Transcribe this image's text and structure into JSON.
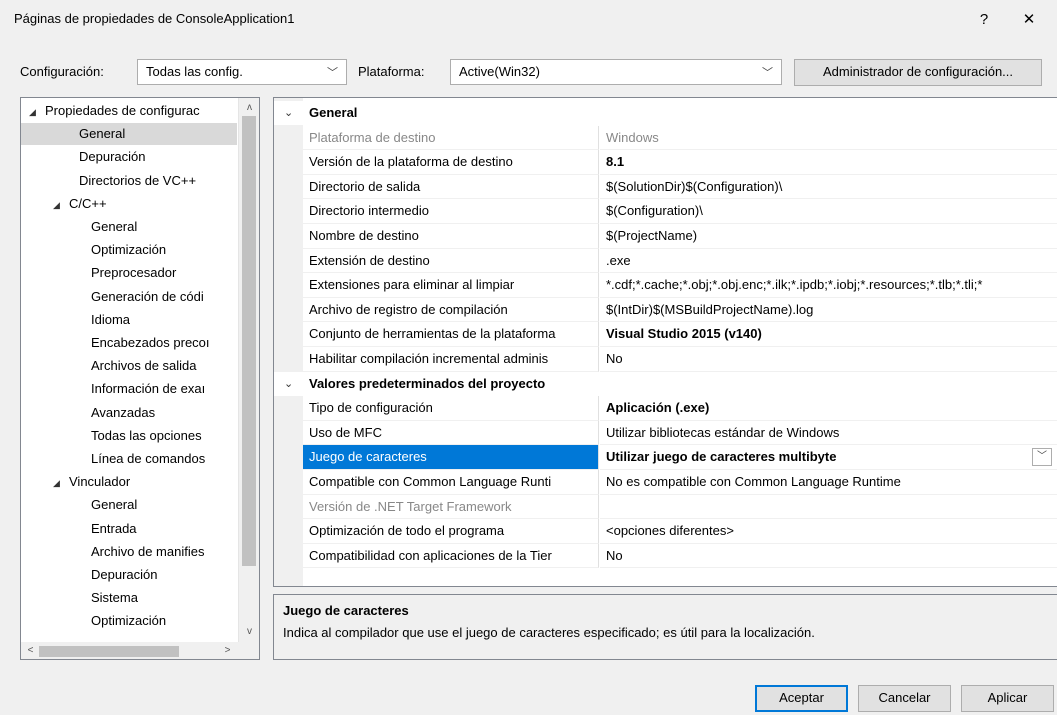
{
  "window": {
    "title": "Páginas de propiedades de ConsoleApplication1",
    "help_glyph": "?",
    "close_glyph": "✕"
  },
  "toolbar": {
    "config_label": "Configuración:",
    "config_value": "Todas las config.",
    "platform_label": "Plataforma:",
    "platform_value": "Active(Win32)",
    "config_manager_label": "Administrador de configuración...",
    "chevron": "﹀"
  },
  "tree": {
    "items": [
      {
        "label": "Propiedades de configurac",
        "indent": 0,
        "expander": "◢"
      },
      {
        "label": "General",
        "indent": 1,
        "expander": ""
      },
      {
        "label": "Depuración",
        "indent": 1,
        "expander": ""
      },
      {
        "label": "Directorios de VC++",
        "indent": 1,
        "expander": ""
      },
      {
        "label": "C/C++",
        "indent": 1,
        "expander": "◢"
      },
      {
        "label": "General",
        "indent": 2,
        "expander": ""
      },
      {
        "label": "Optimización",
        "indent": 2,
        "expander": ""
      },
      {
        "label": "Preprocesador",
        "indent": 2,
        "expander": ""
      },
      {
        "label": "Generación de códi",
        "indent": 2,
        "expander": ""
      },
      {
        "label": "Idioma",
        "indent": 2,
        "expander": ""
      },
      {
        "label": "Encabezados precoı",
        "indent": 2,
        "expander": ""
      },
      {
        "label": "Archivos de salida",
        "indent": 2,
        "expander": ""
      },
      {
        "label": "Información de exaı",
        "indent": 2,
        "expander": ""
      },
      {
        "label": "Avanzadas",
        "indent": 2,
        "expander": ""
      },
      {
        "label": "Todas las opciones",
        "indent": 2,
        "expander": ""
      },
      {
        "label": "Línea de comandos",
        "indent": 2,
        "expander": ""
      },
      {
        "label": "Vinculador",
        "indent": 1,
        "expander": "◢"
      },
      {
        "label": "General",
        "indent": 2,
        "expander": ""
      },
      {
        "label": "Entrada",
        "indent": 2,
        "expander": ""
      },
      {
        "label": "Archivo de manifies",
        "indent": 2,
        "expander": ""
      },
      {
        "label": "Depuración",
        "indent": 2,
        "expander": ""
      },
      {
        "label": "Sistema",
        "indent": 2,
        "expander": ""
      },
      {
        "label": "Optimización",
        "indent": 2,
        "expander": ""
      }
    ],
    "selected_index": 1,
    "scroll_up": "ʌ",
    "scroll_down": "v",
    "scroll_left": "<",
    "scroll_right": ">"
  },
  "grid": {
    "sections": [
      {
        "title": "General",
        "rows": [
          {
            "name": "Plataforma de destino",
            "value": "Windows",
            "dim": true
          },
          {
            "name": "Versión de la plataforma de destino",
            "value": "8.1",
            "bold": true
          },
          {
            "name": "Directorio de salida",
            "value": "$(SolutionDir)$(Configuration)\\"
          },
          {
            "name": "Directorio intermedio",
            "value": "$(Configuration)\\"
          },
          {
            "name": "Nombre de destino",
            "value": "$(ProjectName)"
          },
          {
            "name": "Extensión de destino",
            "value": ".exe"
          },
          {
            "name": "Extensiones para eliminar al limpiar",
            "value": "*.cdf;*.cache;*.obj;*.obj.enc;*.ilk;*.ipdb;*.iobj;*.resources;*.tlb;*.tli;*"
          },
          {
            "name": "Archivo de registro de compilación",
            "value": "$(IntDir)$(MSBuildProjectName).log"
          },
          {
            "name": "Conjunto de herramientas de la plataforma",
            "value": "Visual Studio 2015 (v140)",
            "bold": true
          },
          {
            "name": "Habilitar compilación incremental adminis",
            "value": "No"
          }
        ]
      },
      {
        "title": "Valores predeterminados del proyecto",
        "rows": [
          {
            "name": "Tipo de configuración",
            "value": "Aplicación (.exe)",
            "bold": true
          },
          {
            "name": "Uso de MFC",
            "value": "Utilizar bibliotecas estándar de Windows"
          },
          {
            "name": "Juego de caracteres",
            "value": "Utilizar juego de caracteres multibyte",
            "bold": true,
            "selected": true
          },
          {
            "name": "Compatible con Common Language Runti",
            "value": "No es compatible con Common Language Runtime"
          },
          {
            "name": "Versión de .NET Target Framework",
            "value": "",
            "dim": true
          },
          {
            "name": "Optimización de todo el programa",
            "value": "<opciones diferentes>"
          },
          {
            "name": "Compatibilidad con aplicaciones de la Tier",
            "value": "No"
          }
        ]
      }
    ],
    "section_chevron": "⌄",
    "dropdown_glyph": "﹀"
  },
  "description": {
    "title": "Juego de caracteres",
    "text": "Indica al compilador que use el juego de caracteres especificado; es útil para la localización."
  },
  "buttons": {
    "ok": "Aceptar",
    "cancel": "Cancelar",
    "apply": "Aplicar"
  }
}
